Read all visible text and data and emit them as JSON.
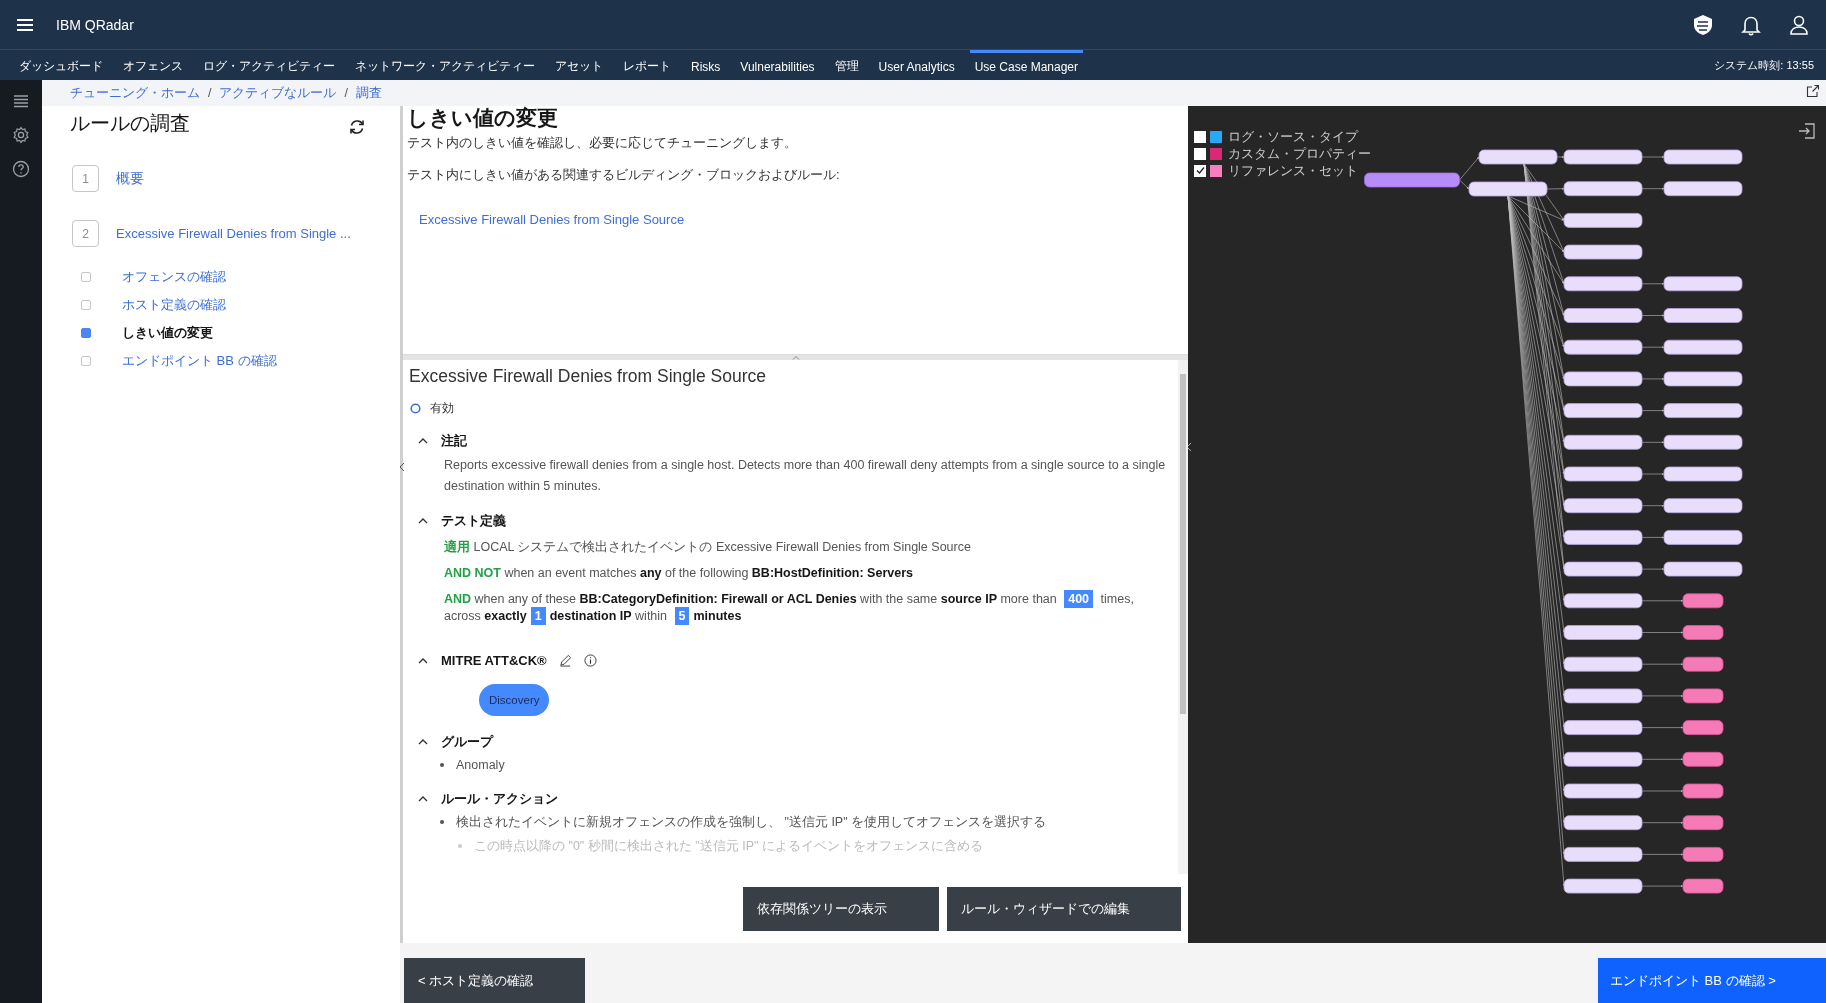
{
  "header": {
    "product": "IBM QRadar"
  },
  "nav": {
    "items": [
      {
        "label": "ダッシュボード",
        "selected": false
      },
      {
        "label": "オフェンス",
        "selected": false
      },
      {
        "label": "ログ・アクティビティー",
        "selected": false
      },
      {
        "label": "ネットワーク・アクティビティー",
        "selected": false
      },
      {
        "label": "アセット",
        "selected": false
      },
      {
        "label": "レポート",
        "selected": false
      },
      {
        "label": "Risks",
        "selected": false
      },
      {
        "label": "Vulnerabilities",
        "selected": false
      },
      {
        "label": "管理",
        "selected": false
      },
      {
        "label": "User Analytics",
        "selected": false
      },
      {
        "label": "Use Case Manager",
        "selected": true
      }
    ],
    "system_time": "システム時刻: 13:55"
  },
  "breadcrumbs": {
    "items": [
      "チューニング・ホーム",
      "アクティブなルール",
      "調査"
    ],
    "separator": "/"
  },
  "left_panel": {
    "title": "ルールの調査",
    "steps": [
      {
        "number": "1",
        "label": "概要"
      },
      {
        "number": "2",
        "label": "Excessive Firewall Denies from Single ...",
        "substeps": [
          {
            "label": "オフェンスの確認",
            "selected": false
          },
          {
            "label": "ホスト定義の確認",
            "selected": false
          },
          {
            "label": "しきい値の変更",
            "selected": true
          },
          {
            "label": "エンドポイント BB の確認",
            "selected": false
          }
        ]
      }
    ]
  },
  "threshold": {
    "title": "しきい値の変更",
    "description": "テスト内のしきい値を確認し、必要に応じてチューニングします。",
    "related_label": "テスト内にしきい値がある関連するビルディング・ブロックおよびルール:",
    "related_rules": [
      "Excessive Firewall Denies from Single Source"
    ]
  },
  "rule": {
    "name": "Excessive Firewall Denies from Single Source",
    "status": "有効",
    "sections": [
      {
        "kind": "text",
        "title": "注記",
        "expanded": true,
        "text": "Reports excessive firewall denies from a single host. Detects more than 400 firewall deny attempts from a single source to a single destination within 5 minutes."
      },
      {
        "kind": "tests",
        "title": "テスト定義",
        "expanded": true,
        "lines": [
          [
            {
              "kind": "keyword",
              "text": "適用"
            },
            {
              "kind": "plain",
              "text": " LOCAL システムで検出されたイベントの Excessive Firewall Denies from Single Source"
            }
          ],
          [
            {
              "kind": "keyword",
              "text": "AND NOT"
            },
            {
              "kind": "plain",
              "text": " when an event matches "
            },
            {
              "kind": "bold",
              "text": "any"
            },
            {
              "kind": "plain",
              "text": " of the following "
            },
            {
              "kind": "bold",
              "text": "BB:HostDefinition: Servers"
            }
          ],
          [
            {
              "kind": "keyword",
              "text": "AND"
            },
            {
              "kind": "plain",
              "text": " when any of these "
            },
            {
              "kind": "bold",
              "text": "BB:CategoryDefinition: Firewall or ACL Denies"
            },
            {
              "kind": "plain",
              "text": " with the same "
            },
            {
              "kind": "bold",
              "text": "source IP"
            },
            {
              "kind": "plain",
              "text": " more than "
            },
            {
              "kind": "value",
              "text": "400"
            },
            {
              "kind": "plain",
              "text": " times, across "
            },
            {
              "kind": "bold",
              "text": "exactly"
            },
            {
              "kind": "value",
              "text": "1"
            },
            {
              "kind": "bold",
              "text": "destination IP"
            },
            {
              "kind": "plain",
              "text": " within "
            },
            {
              "kind": "value",
              "text": "5"
            },
            {
              "kind": "bold",
              "text": "minutes"
            }
          ]
        ]
      },
      {
        "kind": "tags",
        "title": "MITRE ATT&CK®",
        "expanded": true,
        "tags": [
          "Discovery"
        ]
      },
      {
        "kind": "list",
        "title": "グループ",
        "expanded": true,
        "items": [
          {
            "text": "Anomaly"
          }
        ]
      },
      {
        "kind": "list",
        "title": "ルール・アクション",
        "expanded": true,
        "items": [
          {
            "text": "検出されたイベントに新規オフェンスの作成を強制し、 \"送信元 IP\" を使用してオフェンスを選択する",
            "children": [
              {
                "text": "この時点以降の \"0\" 秒間に検出された \"送信元 IP\" によるイベントをオフェンスに含める"
              }
            ]
          }
        ]
      }
    ]
  },
  "actions": [
    "依存関係ツリーの表示",
    "ルール・ウィザードでの編集"
  ],
  "graph": {
    "legend": [
      {
        "label": "ログ・ソース・タイプ",
        "checked": false,
        "color": "#29a8f5"
      },
      {
        "label": "カスタム・プロパティー",
        "checked": false,
        "color": "#d92876"
      },
      {
        "label": "リファレンス・セット",
        "checked": true,
        "color": "#f77fbe"
      }
    ],
    "root": {
      "kind": "rule"
    },
    "parents": [
      {
        "kind": "building_block"
      },
      {
        "kind": "building_block"
      }
    ],
    "rows": [
      {
        "node": {
          "kind": "building_block"
        },
        "target": {
          "kind": "building_block"
        }
      },
      {
        "node": {
          "kind": "building_block"
        },
        "target": {
          "kind": "building_block"
        }
      },
      {
        "node": {
          "kind": "building_block"
        }
      },
      {
        "node": {
          "kind": "building_block"
        }
      },
      {
        "node": {
          "kind": "building_block"
        },
        "target": {
          "kind": "building_block"
        }
      },
      {
        "node": {
          "kind": "building_block"
        },
        "target": {
          "kind": "building_block"
        }
      },
      {
        "node": {
          "kind": "building_block"
        },
        "target": {
          "kind": "building_block"
        }
      },
      {
        "node": {
          "kind": "building_block"
        },
        "target": {
          "kind": "building_block"
        }
      },
      {
        "node": {
          "kind": "building_block"
        },
        "target": {
          "kind": "building_block"
        }
      },
      {
        "node": {
          "kind": "building_block"
        },
        "target": {
          "kind": "building_block"
        }
      },
      {
        "node": {
          "kind": "building_block"
        },
        "target": {
          "kind": "building_block"
        }
      },
      {
        "node": {
          "kind": "building_block"
        },
        "target": {
          "kind": "building_block"
        }
      },
      {
        "node": {
          "kind": "building_block"
        },
        "target": {
          "kind": "building_block"
        }
      },
      {
        "node": {
          "kind": "building_block"
        },
        "target": {
          "kind": "building_block"
        }
      },
      {
        "node": {
          "kind": "building_block"
        },
        "target": {
          "kind": "reference_set"
        }
      },
      {
        "node": {
          "kind": "building_block"
        },
        "target": {
          "kind": "reference_set"
        }
      },
      {
        "node": {
          "kind": "building_block"
        },
        "target": {
          "kind": "reference_set"
        }
      },
      {
        "node": {
          "kind": "building_block"
        },
        "target": {
          "kind": "reference_set"
        }
      },
      {
        "node": {
          "kind": "building_block"
        },
        "target": {
          "kind": "reference_set"
        }
      },
      {
        "node": {
          "kind": "building_block"
        },
        "target": {
          "kind": "reference_set"
        }
      },
      {
        "node": {
          "kind": "building_block"
        },
        "target": {
          "kind": "reference_set"
        }
      },
      {
        "node": {
          "kind": "building_block"
        },
        "target": {
          "kind": "reference_set"
        }
      },
      {
        "node": {
          "kind": "building_block"
        },
        "target": {
          "kind": "reference_set"
        }
      },
      {
        "node": {
          "kind": "building_block"
        },
        "target": {
          "kind": "reference_set"
        }
      }
    ]
  },
  "footer": {
    "back": "< ホスト定義の確認",
    "next": "エンドポイント BB の確認 >"
  }
}
